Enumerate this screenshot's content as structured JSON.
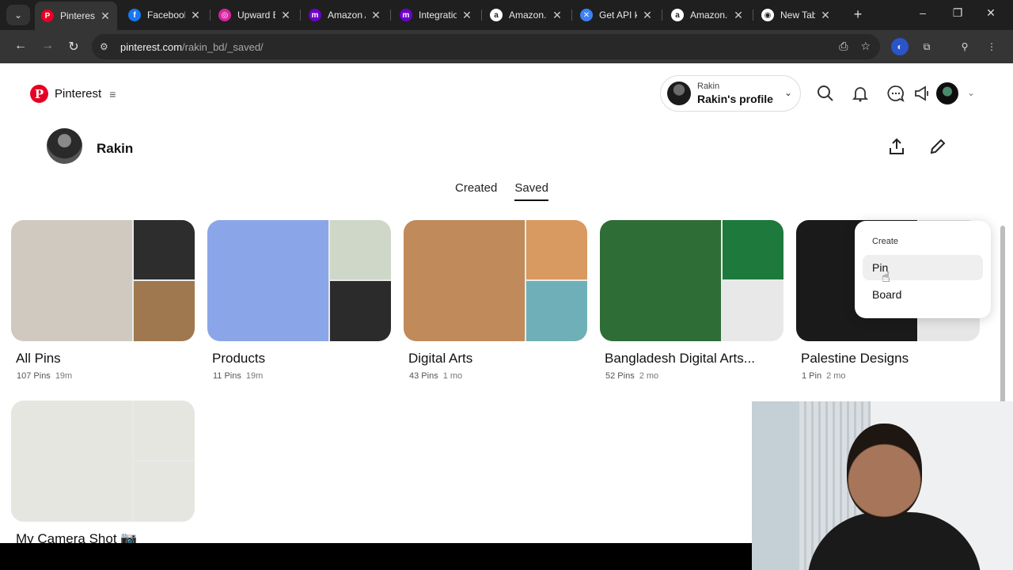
{
  "browser": {
    "tabs": [
      {
        "label": "Pinterest",
        "icon": "pinterest-icon",
        "color": "#e60023",
        "glyph": "P",
        "active": true
      },
      {
        "label": "Facebook",
        "icon": "facebook-icon",
        "color": "#1877f2",
        "glyph": "f"
      },
      {
        "label": "Upward E",
        "icon": "instagram-icon",
        "color": "#d6249f",
        "glyph": "◎"
      },
      {
        "label": "Amazon A",
        "icon": "make-icon",
        "color": "#6d00cc",
        "glyph": "m"
      },
      {
        "label": "Integratio",
        "icon": "make-icon",
        "color": "#6d00cc",
        "glyph": "m"
      },
      {
        "label": "Amazon.c",
        "icon": "amazon-icon",
        "color": "#ffffff",
        "glyph": "a"
      },
      {
        "label": "Get API k",
        "icon": "api-icon",
        "color": "#3b82f6",
        "glyph": "✕"
      },
      {
        "label": "Amazon.c",
        "icon": "amazon-icon",
        "color": "#ffffff",
        "glyph": "a"
      },
      {
        "label": "New Tab",
        "icon": "chrome-icon",
        "color": "#ffffff",
        "glyph": "◉"
      }
    ],
    "url_host": "pinterest.com",
    "url_path": "/rakin_bd/_saved/"
  },
  "header": {
    "logo_text": "Pinterest",
    "profile_small": "Rakin",
    "profile_big": "Rakin's profile"
  },
  "profile": {
    "name": "Rakin"
  },
  "tabs": {
    "created": "Created",
    "saved": "Saved"
  },
  "boards": [
    {
      "title": "All Pins",
      "pins": "107 Pins",
      "time": "19m",
      "colors": [
        "#cfc9bf",
        "#2d2d2d",
        "#a07850"
      ]
    },
    {
      "title": "Products",
      "pins": "11 Pins",
      "time": "19m",
      "colors": [
        "#8aa6e8",
        "#cfd7c8",
        "#2b2b2b"
      ]
    },
    {
      "title": "Digital Arts",
      "pins": "43 Pins",
      "time": "1 mo",
      "colors": [
        "#c08a5a",
        "#d89a60",
        "#6fb0b8"
      ]
    },
    {
      "title": "Bangladesh Digital Arts...",
      "pins": "52 Pins",
      "time": "2 mo",
      "colors": [
        "#2f6d37",
        "#1d7a3c",
        "#e8e8e8"
      ]
    },
    {
      "title": "Palestine Designs",
      "pins": "1 Pin",
      "time": "2 mo",
      "colors": [
        "#1a1a1a",
        "#d8d8d8",
        "#e6e6e6"
      ]
    },
    {
      "title": "My Camera Shot 📷",
      "pins": "",
      "time": "",
      "colors": [
        "#e6e6e1",
        "#e6e6e1",
        "#e6e6e1"
      ]
    }
  ],
  "create_menu": {
    "title": "Create",
    "items": [
      "Pin",
      "Board"
    ]
  }
}
